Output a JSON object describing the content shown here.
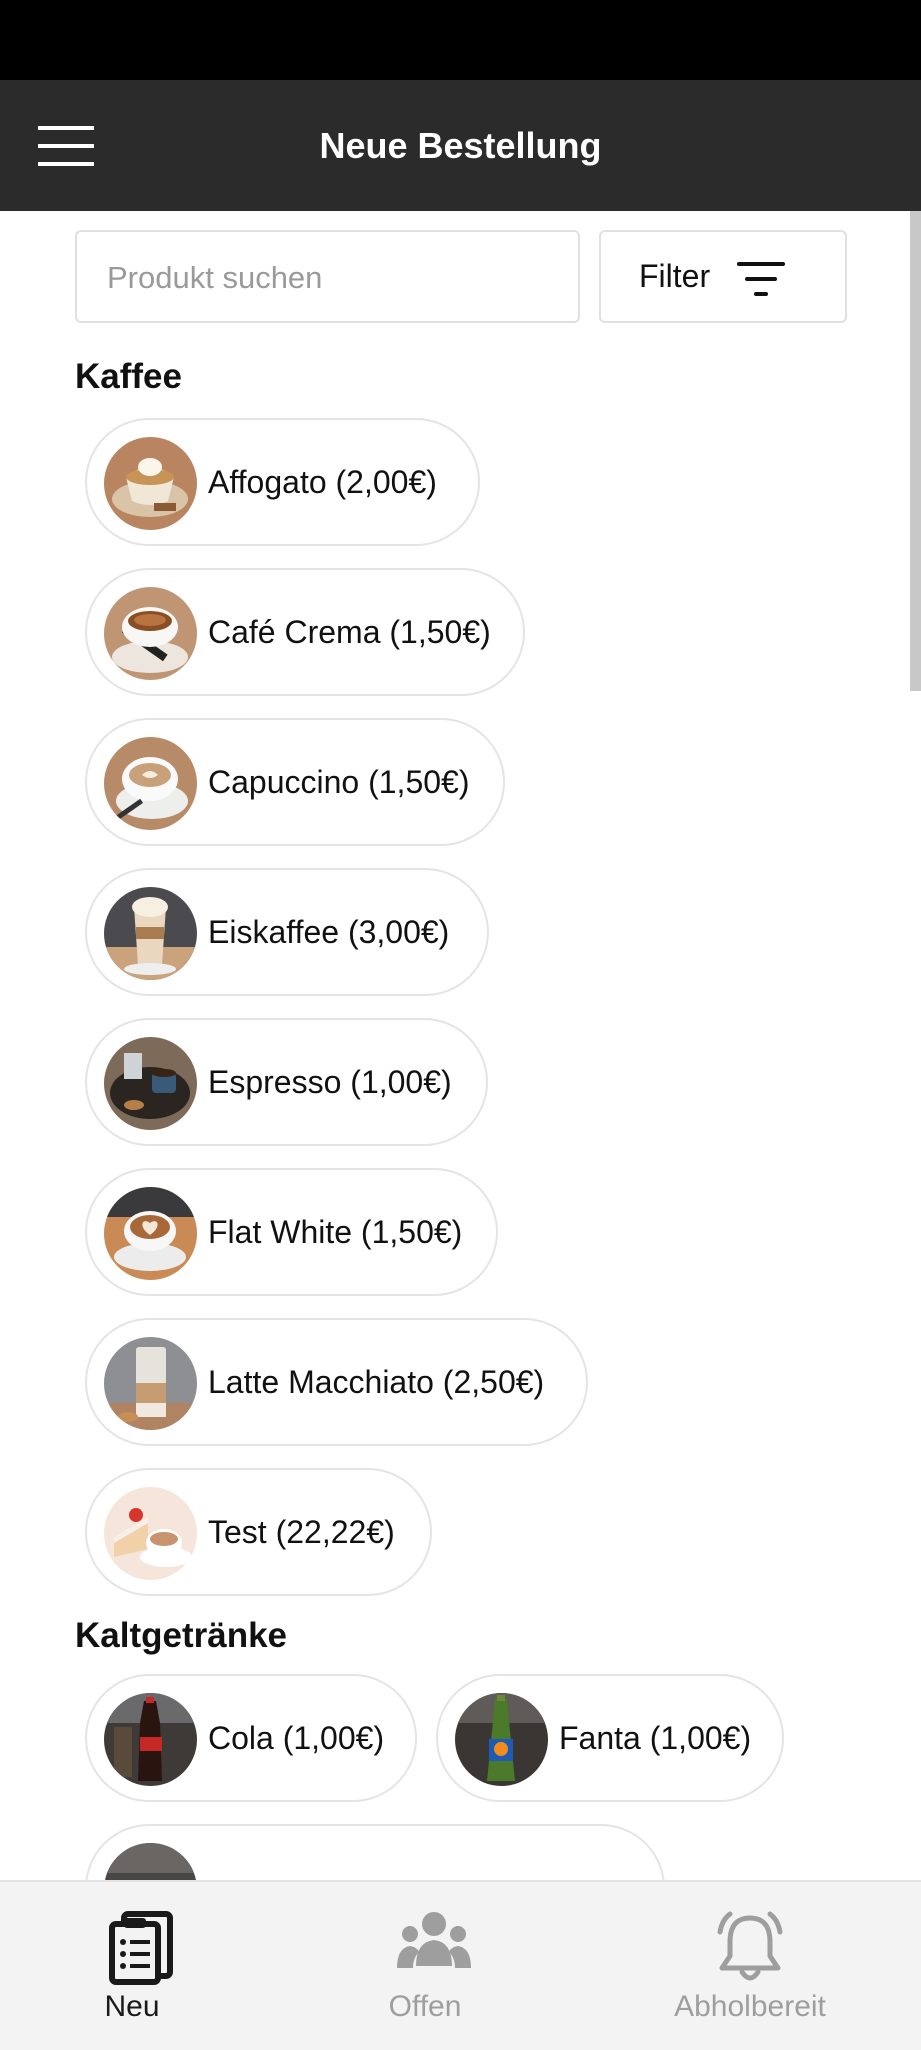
{
  "app_bar": {
    "title": "Neue Bestellung",
    "menu_icon": "hamburger-menu-icon"
  },
  "search": {
    "placeholder": "Produkt suchen",
    "value": ""
  },
  "filter": {
    "label": "Filter",
    "icon": "filter-lines-icon"
  },
  "categories": [
    {
      "title": "Kaffee",
      "products": [
        {
          "label": "Affogato (2,00€)"
        },
        {
          "label": "Café Crema (1,50€)"
        },
        {
          "label": "Capuccino (1,50€)"
        },
        {
          "label": "Eiskaffee (3,00€)"
        },
        {
          "label": "Espresso (1,00€)"
        },
        {
          "label": "Flat White (1,50€)"
        },
        {
          "label": "Latte Macchiato (2,50€)"
        },
        {
          "label": "Test (22,22€)"
        }
      ]
    },
    {
      "title": "Kaltgetränke",
      "products": [
        {
          "label": "Cola (1,00€)"
        },
        {
          "label": "Fanta (1,00€)"
        }
      ]
    }
  ],
  "bottom_nav": [
    {
      "label": "Neu",
      "icon": "clipboard-list-icon",
      "active": true
    },
    {
      "label": "Offen",
      "icon": "users-group-icon",
      "active": false
    },
    {
      "label": "Abholbereit",
      "icon": "bell-icon",
      "active": false
    }
  ],
  "colors": {
    "app_bar": "#2b2b2b",
    "nav_active": "#1a1a1a",
    "nav_inactive": "#9e9e9e"
  }
}
